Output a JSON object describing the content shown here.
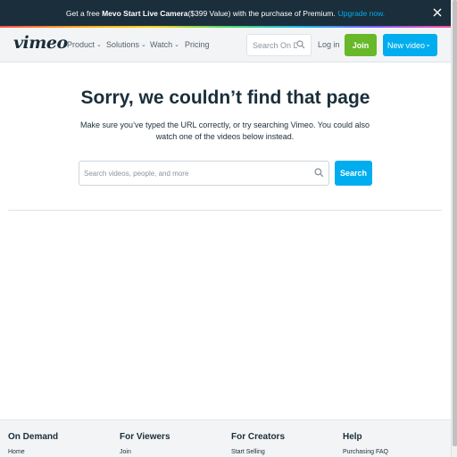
{
  "promo": {
    "prefix": "Get a free",
    "product": "Mevo Start Live Camera",
    "suffix": " ($399 Value) with the purchase of Premium.",
    "link": "Upgrade now.",
    "close_icon": "close-icon"
  },
  "header": {
    "logo": "vimeo",
    "nav": [
      {
        "label": "Product",
        "has_dropdown": true
      },
      {
        "label": "Solutions",
        "has_dropdown": true
      },
      {
        "label": "Watch",
        "has_dropdown": true
      },
      {
        "label": "Pricing",
        "has_dropdown": false
      }
    ],
    "search_placeholder": "Search On Demand",
    "login": "Log in",
    "join": "Join",
    "new_video": "New video"
  },
  "main": {
    "title": "Sorry, we couldn’t find that page",
    "subtitle": "Make sure you’ve typed the URL correctly, or try searching Vimeo. You could also watch one of the videos below instead.",
    "search_placeholder": "Search videos, people, and more",
    "search_button": "Search"
  },
  "footer": {
    "columns": [
      {
        "heading": "On Demand",
        "first_link": "Home"
      },
      {
        "heading": "For Viewers",
        "first_link": "Join"
      },
      {
        "heading": "For Creators",
        "first_link": "Start Selling"
      },
      {
        "heading": "Help",
        "first_link": "Purchasing FAQ"
      }
    ]
  },
  "colors": {
    "navy": "#1a2e3b",
    "accent_blue": "#00adef",
    "join_green": "#68b82a",
    "header_bg": "#f3f4f5"
  }
}
